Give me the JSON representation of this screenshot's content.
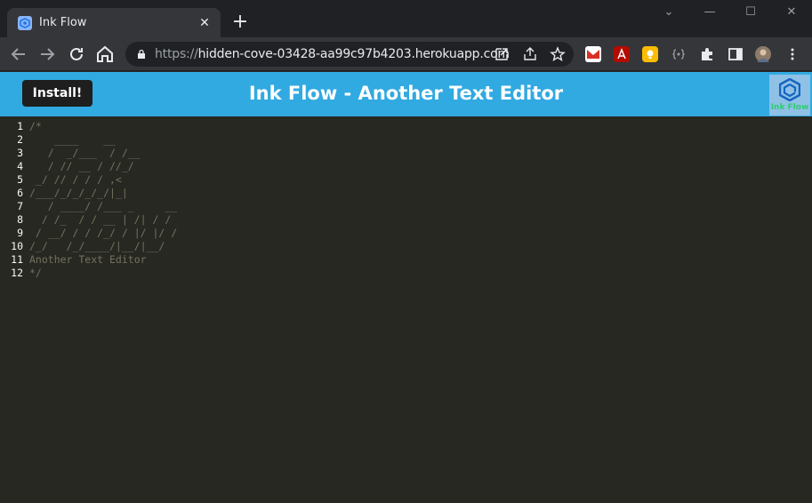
{
  "browser": {
    "tab_title": "Ink Flow",
    "tab_close": "✕",
    "new_tab": "+",
    "url_scheme": "https://",
    "url_host": "hidden-cove-03428-aa99c97b4203.herokuapp.com",
    "window_controls": {
      "minimize": "—",
      "maximize": "☐",
      "close": "✕",
      "dropdown": "⌄"
    }
  },
  "app": {
    "install_label": "Install!",
    "title": "Ink Flow - Another Text Editor",
    "logo_text": "Ink Flow",
    "colors": {
      "header": "#31a9e1",
      "editor_bg": "#272822",
      "comment": "#75715e",
      "line_number": "#f8f8f2"
    }
  },
  "editor": {
    "line_numbers": [
      "1",
      "2",
      "3",
      "4",
      "5",
      "6",
      "7",
      "8",
      "9",
      "10",
      "11",
      "12"
    ],
    "lines": [
      "/*",
      "    ____    __",
      "   /  _/___  / /__",
      "   / // __ / //_/",
      " _/ // / / / ,<",
      "/___/_/_/_/_/|_|",
      "   / ____/ /___ _     __",
      "  / /_  / / __ | /| / /",
      " / __/ / / /_/ / |/ |/ /",
      "/_/   /_/____/|__/|__/",
      "Another Text Editor",
      "*/"
    ]
  }
}
